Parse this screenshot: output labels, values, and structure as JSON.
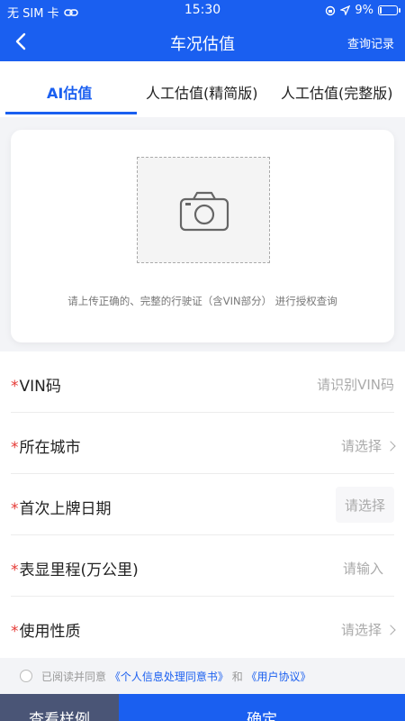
{
  "status_bar": {
    "carrier": "无 SIM 卡",
    "time": "15:30",
    "battery": "9%",
    "battery_level": 0.09
  },
  "nav": {
    "title": "车况估值",
    "records": "查询记录"
  },
  "tabs": [
    {
      "label": "AI估值",
      "active": true
    },
    {
      "label": "人工估值(精简版)",
      "active": false
    },
    {
      "label": "人工估值(完整版)",
      "active": false
    }
  ],
  "upload": {
    "hint": "请上传正确的、完整的行驶证（含VIN部分） 进行授权查询"
  },
  "form": {
    "rows": [
      {
        "required": "*",
        "label": "VIN码",
        "value": "请识别VIN码"
      },
      {
        "required": "*",
        "label": "所在城市",
        "value": "请选择"
      },
      {
        "required": "*",
        "label": "首次上牌日期",
        "value": "请选择"
      },
      {
        "required": "*",
        "label": "表显里程(万公里)",
        "value": "请输入"
      },
      {
        "required": "*",
        "label": "使用性质",
        "value": "请选择"
      }
    ]
  },
  "agreement": {
    "prefix": "已阅读并同意",
    "link1": "《个人信息处理同意书》",
    "middle": "和",
    "link2": "《用户协议》"
  },
  "buttons": {
    "sample": "查看样例",
    "confirm": "确定"
  },
  "colors": {
    "primary": "#1a5ff0",
    "required": "#e53935",
    "secondary_button": "#4a5576"
  }
}
